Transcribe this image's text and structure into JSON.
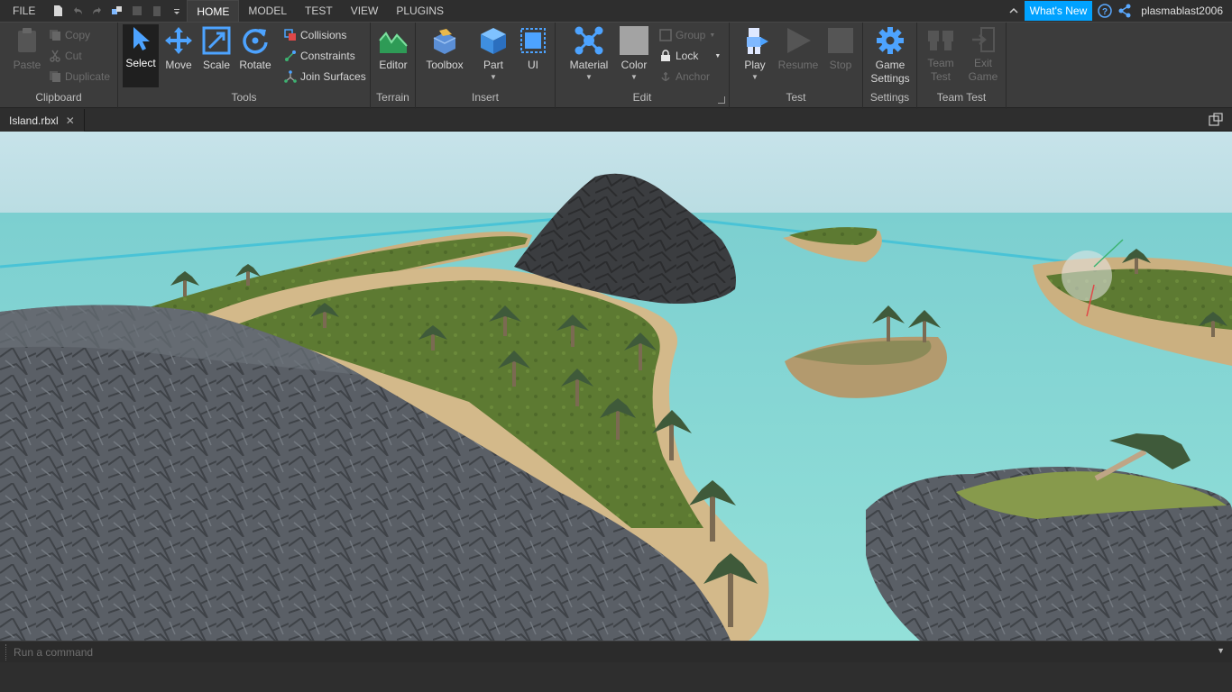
{
  "menu": {
    "file": "FILE",
    "tabs": [
      "HOME",
      "MODEL",
      "TEST",
      "VIEW",
      "PLUGINS"
    ],
    "active_tab": "HOME"
  },
  "topright": {
    "whats_new": "What's New",
    "username": "plasmablast2006"
  },
  "ribbon": {
    "clipboard": {
      "label": "Clipboard",
      "paste": "Paste",
      "copy": "Copy",
      "cut": "Cut",
      "duplicate": "Duplicate"
    },
    "tools": {
      "label": "Tools",
      "select": "Select",
      "move": "Move",
      "scale": "Scale",
      "rotate": "Rotate",
      "collisions": "Collisions",
      "constraints": "Constraints",
      "join_surfaces": "Join Surfaces"
    },
    "terrain": {
      "label": "Terrain",
      "editor": "Editor"
    },
    "insert": {
      "label": "Insert",
      "toolbox": "Toolbox",
      "part": "Part",
      "ui": "UI"
    },
    "edit": {
      "label": "Edit",
      "material": "Material",
      "color": "Color",
      "group": "Group",
      "lock": "Lock",
      "anchor": "Anchor"
    },
    "test": {
      "label": "Test",
      "play": "Play",
      "resume": "Resume",
      "stop": "Stop"
    },
    "settings": {
      "label": "Settings",
      "game_settings_1": "Game",
      "game_settings_2": "Settings"
    },
    "team_test": {
      "label": "Team Test",
      "team_1": "Team",
      "team_2": "Test",
      "exit_1": "Exit",
      "exit_2": "Game"
    }
  },
  "document": {
    "tab_name": "Island.rbxl"
  },
  "command_bar": {
    "placeholder": "Run a command"
  },
  "colors": {
    "accent": "#00a2ff",
    "ribbon_bg": "#3c3c3c",
    "water": "#8fd8d2",
    "sky": "#c9e4ea"
  }
}
